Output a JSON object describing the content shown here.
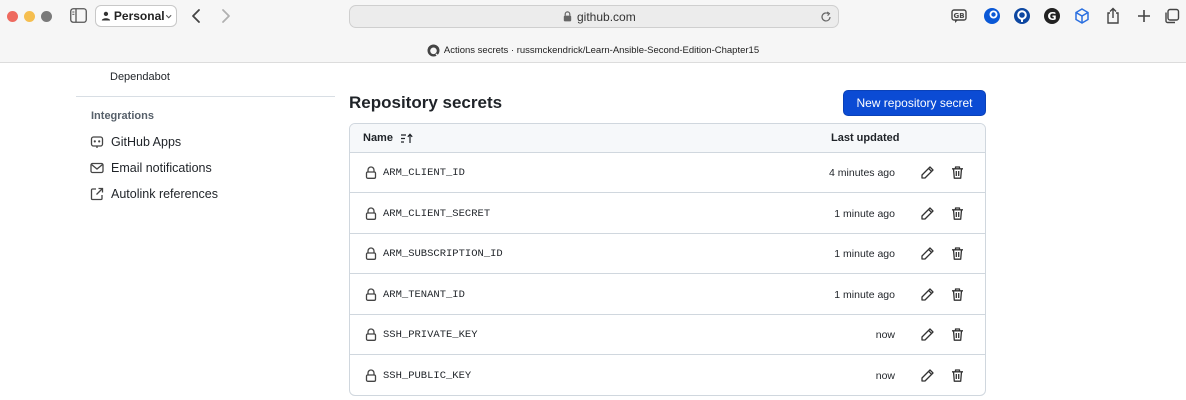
{
  "browser": {
    "profile_label": "Personal",
    "address": "github.com",
    "tab_title": "Actions secrets · russmckendrick/Learn-Ansible-Second-Edition-Chapter15"
  },
  "settings_nav": {
    "dependabot_label": "Dependabot",
    "integrations_heading": "Integrations",
    "items": [
      {
        "label": "GitHub Apps",
        "icon": "apps-icon"
      },
      {
        "label": "Email notifications",
        "icon": "mail-icon"
      },
      {
        "label": "Autolink references",
        "icon": "link-external-icon"
      }
    ]
  },
  "main": {
    "title": "Repository secrets",
    "new_secret_label": "New repository secret",
    "accent_color": "#0b4bd4"
  },
  "table": {
    "columns": {
      "name": "Name",
      "updated": "Last updated"
    },
    "rows": [
      {
        "name": "ARM_CLIENT_ID",
        "updated": "4 minutes ago"
      },
      {
        "name": "ARM_CLIENT_SECRET",
        "updated": "1 minute ago"
      },
      {
        "name": "ARM_SUBSCRIPTION_ID",
        "updated": "1 minute ago"
      },
      {
        "name": "ARM_TENANT_ID",
        "updated": "1 minute ago"
      },
      {
        "name": "SSH_PRIVATE_KEY",
        "updated": "now"
      },
      {
        "name": "SSH_PUBLIC_KEY",
        "updated": "now"
      }
    ]
  }
}
